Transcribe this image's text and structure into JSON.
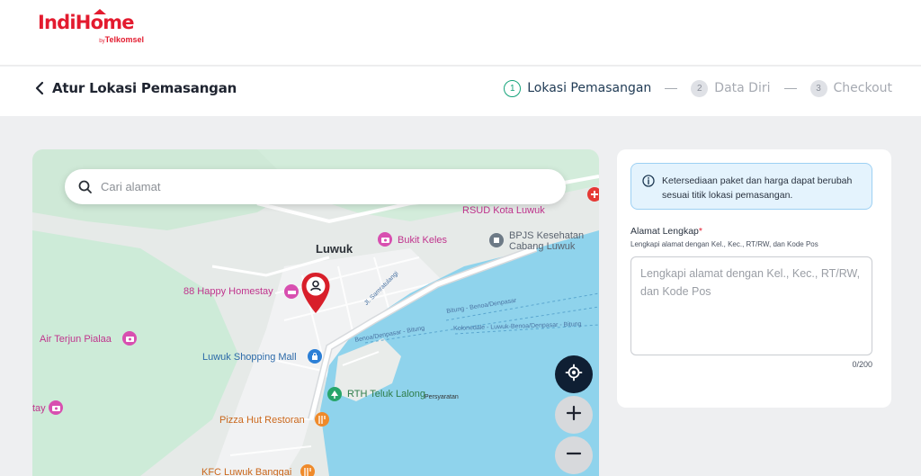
{
  "brand": {
    "name": "IndiHome",
    "by": "by",
    "company": "Telkomsel",
    "color": "#e31b2f"
  },
  "header": {
    "title": "Atur Lokasi Pemasangan",
    "steps": [
      {
        "number": "1",
        "label": "Lokasi Pemasangan",
        "active": true
      },
      {
        "number": "2",
        "label": "Data Diri",
        "active": false
      },
      {
        "number": "3",
        "label": "Checkout",
        "active": false
      }
    ]
  },
  "map": {
    "search_placeholder": "Cari alamat",
    "labels": {
      "town": "Luwuk",
      "rsud": "RSUD Kota Luwuk",
      "bukit": "Bukit Keles",
      "bpjs1": "BPJS Kesehatan",
      "bpjs2": "Cabang Luwuk",
      "homestay": "88 Happy Homestay",
      "airterjun": "Air Terjun Pialaa",
      "mall": "Luwuk Shopping Mall",
      "rth": "RTH Teluk Lalong",
      "pizza": "Pizza Hut Restoran",
      "kfc": "KFC Luwuk Banggai",
      "tay": "tay",
      "road_samratulangi": "Jl. Samratulangi",
      "ferry1": "Bitung - Benoa/Denpasar",
      "ferry2": "Benoa/Denpasar - Bitung",
      "ferry3": "Kolonedale - Luwuk-Benoa/Denpasar - Bitung",
      "persyaratan": "Persyaratan"
    },
    "colors": {
      "water": "#8fd3ec",
      "land": "#e6eae8",
      "green": "#cdebd8",
      "pin": "#d81f2a",
      "locate_button": "#0f1f33"
    },
    "icons": [
      "search-icon",
      "map-pin-icon",
      "locate-icon",
      "plus-icon",
      "minus-icon"
    ]
  },
  "panel": {
    "info": "Ketersediaan paket dan harga dapat berubah sesuai titik lokasi pemasangan.",
    "address_label": "Alamat Lengkap",
    "required_mark": "*",
    "address_hint": "Lengkapi alamat dengan Kel., Kec., RT/RW, dan Kode Pos",
    "address_placeholder": "Lengkapi alamat dengan Kel., Kec., RT/RW, dan Kode Pos",
    "address_value": "",
    "counter": "0/200"
  }
}
